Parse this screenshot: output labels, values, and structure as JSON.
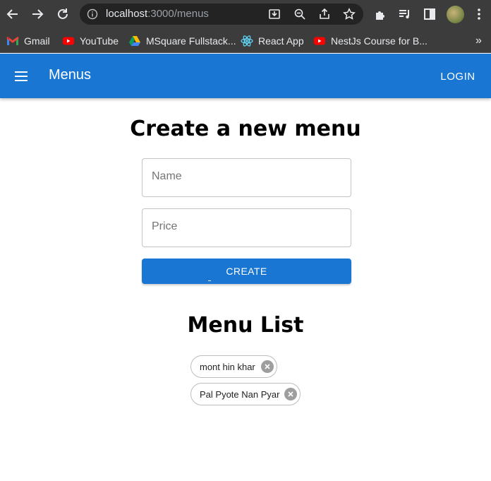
{
  "browser": {
    "url_host": "localhost",
    "url_path": ":3000/menus",
    "bookmarks": [
      {
        "label": "Gmail",
        "icon": "gmail-icon"
      },
      {
        "label": "YouTube",
        "icon": "youtube-icon"
      },
      {
        "label": "MSquare Fullstack...",
        "icon": "drive-icon"
      },
      {
        "label": "React App",
        "icon": "react-icon"
      },
      {
        "label": "NestJs Course for B...",
        "icon": "youtube-icon"
      }
    ],
    "more_bookmarks": "»"
  },
  "appbar": {
    "title": "Menus",
    "login_label": "LOGIN",
    "color": "#1976d2"
  },
  "form": {
    "heading": "Create a new menu",
    "name_placeholder": "Name",
    "name_value": "",
    "price_placeholder": "Price",
    "price_value": "",
    "create_label": "CREATE"
  },
  "menu_list": {
    "heading": "Menu List",
    "items": [
      {
        "label": "mont hin khar"
      },
      {
        "label": "Pal Pyote Nan Pyar"
      }
    ]
  }
}
